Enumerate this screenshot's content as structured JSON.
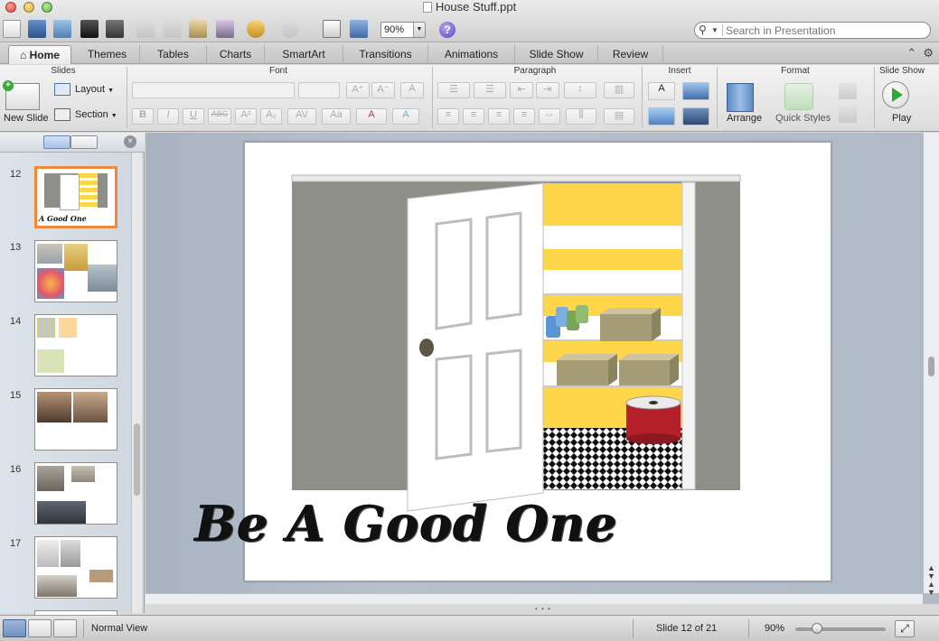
{
  "window": {
    "title": "House Stuff.ppt"
  },
  "toolbar": {
    "zoom_value": "90%",
    "search_placeholder": "Search in Presentation"
  },
  "tabs": [
    "Home",
    "Themes",
    "Tables",
    "Charts",
    "SmartArt",
    "Transitions",
    "Animations",
    "Slide Show",
    "Review"
  ],
  "ribbon": {
    "groups": {
      "slides": "Slides",
      "font": "Font",
      "paragraph": "Paragraph",
      "insert": "Insert",
      "format": "Format",
      "slideshow": "Slide Show"
    },
    "new_slide": "New Slide",
    "layout": "Layout",
    "section": "Section",
    "arrange": "Arrange",
    "quick_styles": "Quick Styles",
    "play": "Play"
  },
  "slides_pane": {
    "numbers": [
      "12",
      "13",
      "14",
      "15",
      "16",
      "17"
    ],
    "selected": "12",
    "thumb12_caption": "A Good One"
  },
  "slide": {
    "caption": "Be A Good One"
  },
  "statusbar": {
    "view_name": "Normal View",
    "slide_counter": "Slide 12 of 21",
    "zoom": "90%"
  },
  "colors": {
    "accent_selected": "#f0883a",
    "wall_gray": "#8f8f8a",
    "stripe_yellow": "#ffd54a",
    "ribbon_red": "#b5202b"
  }
}
